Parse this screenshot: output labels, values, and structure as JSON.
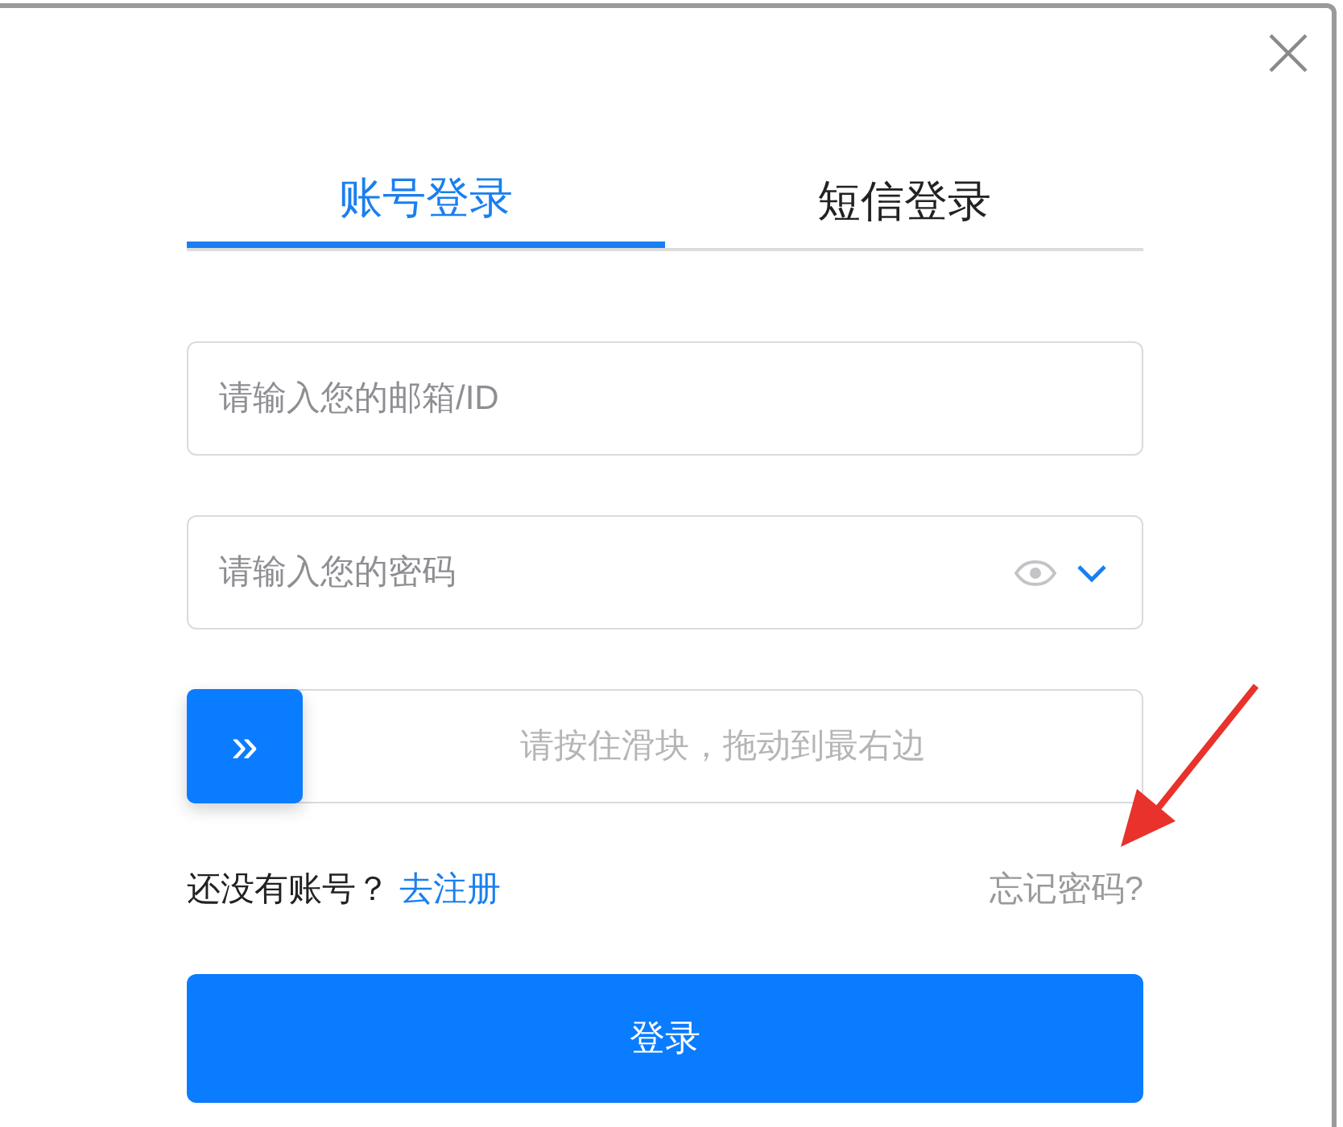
{
  "tabs": [
    {
      "label": "账号登录",
      "selected": true
    },
    {
      "label": "短信登录",
      "selected": false
    }
  ],
  "email_field": {
    "placeholder": "请输入您的邮箱/ID"
  },
  "password_field": {
    "placeholder": "请输入您的密码"
  },
  "slider": {
    "hint": "请按住滑块，拖动到最右边",
    "level": 0,
    "thumb": "»"
  },
  "register_prompt": "还没有账号？",
  "register_link": "去注册",
  "forgot_link": "忘记密码?",
  "login_button": "登录"
}
